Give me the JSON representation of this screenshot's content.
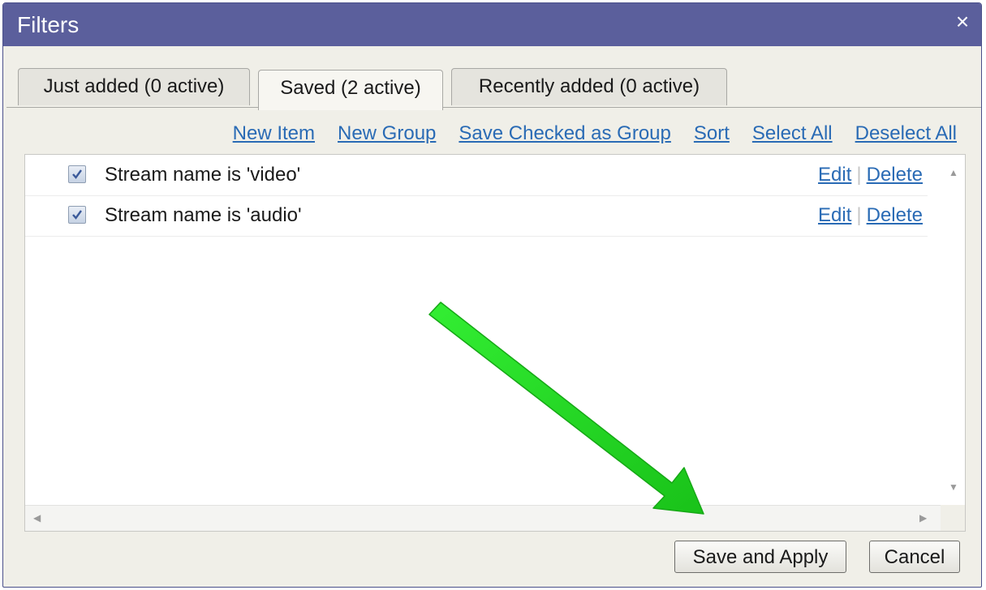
{
  "dialog": {
    "title": "Filters",
    "close_glyph": "×"
  },
  "tabs": [
    {
      "label": "Just added (0 active)",
      "active": false
    },
    {
      "label": "Saved (2 active)",
      "active": true
    },
    {
      "label": "Recently added (0 active)",
      "active": false
    }
  ],
  "toolbar": {
    "new_item": "New Item",
    "new_group": "New Group",
    "save_checked_as_group": "Save Checked as Group",
    "sort": "Sort",
    "select_all": "Select All",
    "deselect_all": "Deselect All"
  },
  "filters": [
    {
      "label": "Stream name is 'video'",
      "checked": true,
      "edit": "Edit",
      "delete": "Delete"
    },
    {
      "label": "Stream name is 'audio'",
      "checked": true,
      "edit": "Edit",
      "delete": "Delete"
    }
  ],
  "buttons": {
    "save_and_apply": "Save and Apply",
    "cancel": "Cancel"
  },
  "icons": {
    "close": "close-icon",
    "checkbox": "checkmark-icon",
    "annotation": "green-arrow-icon"
  },
  "colors": {
    "titlebar": "#5b5f9c",
    "link": "#2a6bb5",
    "annotation_arrow": "#22dd22"
  }
}
